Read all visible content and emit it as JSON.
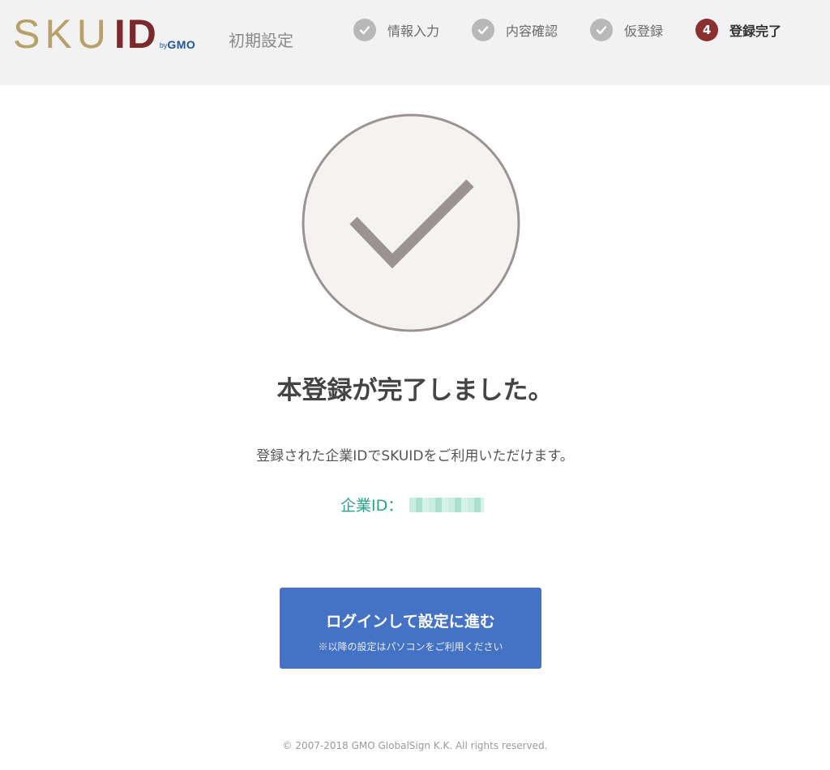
{
  "header": {
    "logo": {
      "sku": "SKU",
      "id": "ID",
      "by": "by",
      "gmo": "GMO"
    },
    "page_label": "初期設定",
    "steps": [
      {
        "label": "情報入力",
        "state": "done"
      },
      {
        "label": "内容確認",
        "state": "done"
      },
      {
        "label": "仮登録",
        "state": "done"
      },
      {
        "number": "4",
        "label": "登録完了",
        "state": "active"
      }
    ]
  },
  "main": {
    "title": "本登録が完了しました。",
    "description": "登録された企業IDでSKUIDをご利用いただけます。",
    "company_id_label": "企業ID："
  },
  "login_button": {
    "label": "ログインして設定に進む",
    "sublabel": "※以降の設定はパソコンをご利用ください"
  },
  "footer": {
    "copyright": "© 2007-2018 GMO GlobalSign K.K. All rights reserved."
  },
  "colors": {
    "brand_gold": "#b8a06a",
    "brand_red": "#7a2a2a",
    "active_step": "#8b2f2f",
    "accent_teal": "#2aa38a",
    "button_blue": "#4472c4"
  }
}
